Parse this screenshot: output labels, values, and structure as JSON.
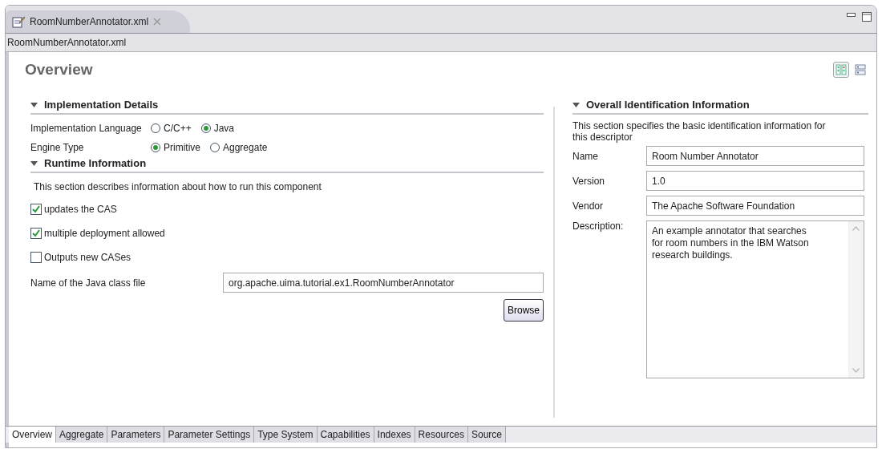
{
  "editor_tab": {
    "title": "RoomNumberAnnotator.xml"
  },
  "breadcrumb": "RoomNumberAnnotator.xml",
  "page_title": "Overview",
  "layout_toggles": [
    {
      "kind": "columns",
      "selected": true
    },
    {
      "kind": "rows",
      "selected": false
    }
  ],
  "implementation": {
    "title": "Implementation Details",
    "expanded": true,
    "rows": [
      {
        "label": "Implementation Language",
        "options": [
          {
            "label": "C/C++",
            "selected": false
          },
          {
            "label": "Java",
            "selected": true
          }
        ]
      },
      {
        "label": "Engine Type",
        "options": [
          {
            "label": "Primitive",
            "selected": true
          },
          {
            "label": "Aggregate",
            "selected": false
          }
        ]
      }
    ]
  },
  "runtime": {
    "title": "Runtime Information",
    "expanded": true,
    "description": "This section describes information about how to run this component",
    "checks": [
      {
        "label": "updates the CAS",
        "checked": true
      },
      {
        "label": "multiple deployment allowed",
        "checked": true
      },
      {
        "label": "Outputs new CASes",
        "checked": false
      }
    ],
    "class_label": "Name of the Java class file",
    "class_value": "org.apache.uima.tutorial.ex1.RoomNumberAnnotator",
    "browse": "Browse"
  },
  "identification": {
    "title": "Overall Identification Information",
    "expanded": true,
    "description": "This section specifies the basic identification information for this descriptor",
    "fields": [
      {
        "label": "Name",
        "value": "Room Number Annotator"
      },
      {
        "label": "Version",
        "value": "1.0"
      },
      {
        "label": "Vendor",
        "value": "The Apache Software Foundation"
      }
    ],
    "description_label": "Description:",
    "description_value": "An example annotator that searches for room numbers in the IBM Watson research buildings."
  },
  "page_tabs": [
    {
      "label": "Overview",
      "selected": true
    },
    {
      "label": "Aggregate",
      "selected": false
    },
    {
      "label": "Parameters",
      "selected": false
    },
    {
      "label": "Parameter Settings",
      "selected": false
    },
    {
      "label": "Type System",
      "selected": false
    },
    {
      "label": "Capabilities",
      "selected": false
    },
    {
      "label": "Indexes",
      "selected": false
    },
    {
      "label": "Resources",
      "selected": false
    },
    {
      "label": "Source",
      "selected": false
    }
  ]
}
